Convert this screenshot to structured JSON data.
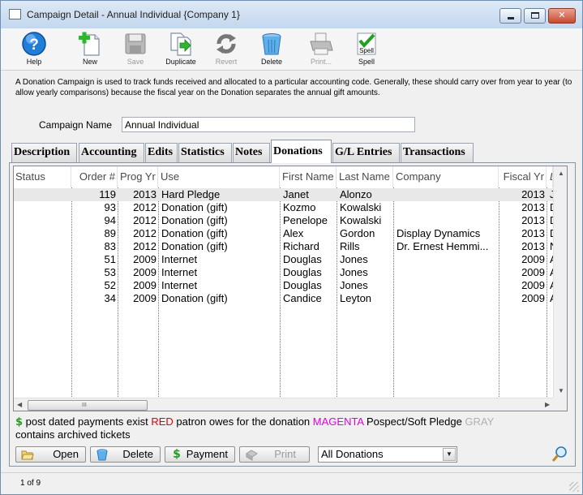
{
  "window": {
    "title": "Campaign Detail - Annual Individual {Company 1}"
  },
  "toolbar": {
    "help": "Help",
    "new": "New",
    "save": "Save",
    "duplicate": "Duplicate",
    "revert": "Revert",
    "delete": "Delete",
    "print": "Print...",
    "spell": "Spell",
    "spell_icon_text": "Spell"
  },
  "description": "A Donation Campaign is used to track funds received and allocated to a particular accounting code.  Generally, these should carry over from year to year (to allow yearly comparisons) because the fiscal year on the Donation separates the annual gift amounts.",
  "campaign": {
    "label": "Campaign Name",
    "value": "Annual Individual"
  },
  "tabs": [
    "Description",
    "Accounting",
    "Edits",
    "Statistics",
    "Notes",
    "Donations",
    "G/L Entries",
    "Transactions"
  ],
  "active_tab": "Donations",
  "grid": {
    "columns": [
      "Status",
      "Order #",
      "Prog Yr",
      "Use",
      "First Name",
      "Last Name",
      "Company",
      "Fiscal Yr",
      "Don"
    ],
    "rows": [
      {
        "status": "",
        "order": "119",
        "prog_yr": "2013",
        "use": "Hard Pledge",
        "first": "Janet",
        "last": "Alonzo",
        "company": "",
        "fiscal_yr": "2013",
        "don": "J"
      },
      {
        "status": "",
        "order": "93",
        "prog_yr": "2012",
        "use": "Donation (gift)",
        "first": "Kozmo",
        "last": "Kowalski",
        "company": "",
        "fiscal_yr": "2013",
        "don": "D"
      },
      {
        "status": "",
        "order": "94",
        "prog_yr": "2012",
        "use": "Donation (gift)",
        "first": "Penelope",
        "last": "Kowalski",
        "company": "",
        "fiscal_yr": "2013",
        "don": "D"
      },
      {
        "status": "",
        "order": "89",
        "prog_yr": "2012",
        "use": "Donation (gift)",
        "first": "Alex",
        "last": "Gordon",
        "company": "Display Dynamics",
        "fiscal_yr": "2013",
        "don": "D"
      },
      {
        "status": "",
        "order": "83",
        "prog_yr": "2012",
        "use": "Donation (gift)",
        "first": "Richard",
        "last": "Rills",
        "company": "Dr. Ernest Hemmi...",
        "fiscal_yr": "2013",
        "don": "N"
      },
      {
        "status": "",
        "order": "51",
        "prog_yr": "2009",
        "use": "Internet",
        "first": "Douglas",
        "last": "Jones",
        "company": "",
        "fiscal_yr": "2009",
        "don": "A"
      },
      {
        "status": "",
        "order": "53",
        "prog_yr": "2009",
        "use": "Internet",
        "first": "Douglas",
        "last": "Jones",
        "company": "",
        "fiscal_yr": "2009",
        "don": "A"
      },
      {
        "status": "",
        "order": "52",
        "prog_yr": "2009",
        "use": "Internet",
        "first": "Douglas",
        "last": "Jones",
        "company": "",
        "fiscal_yr": "2009",
        "don": "A"
      },
      {
        "status": "",
        "order": "34",
        "prog_yr": "2009",
        "use": "Donation (gift)",
        "first": "Candice",
        "last": "Leyton",
        "company": "",
        "fiscal_yr": "2009",
        "don": "A"
      }
    ],
    "selected_row": 0,
    "hscroll_grip": "III"
  },
  "legend": {
    "dollar_symbol": "$",
    "dollar_text": " post dated payments exist ",
    "red_word": "RED",
    "red_text": " patron owes for the donation ",
    "magenta_word": "MAGENTA",
    "magenta_text": " Pospect/Soft Pledge ",
    "gray_word": "GRAY",
    "gray_text": "contains archived tickets"
  },
  "actions": {
    "open": "Open",
    "delete": "Delete",
    "payment": "Payment",
    "print": "Print"
  },
  "filter": {
    "selected": "All Donations"
  },
  "status": {
    "record": "1 of 9"
  },
  "colors": {
    "accent": "#2a6fb5",
    "dollar_green": "#2a9a2a",
    "red": "#e00000",
    "magenta": "#e000e0",
    "gray": "#b0b0b0"
  },
  "icons": {
    "help": "help-icon",
    "new": "new-document-icon",
    "save": "save-disk-icon",
    "duplicate": "duplicate-icon",
    "revert": "revert-icon",
    "delete": "delete-trash-icon",
    "print": "print-icon",
    "spell": "spell-check-icon",
    "search": "search-icon"
  }
}
